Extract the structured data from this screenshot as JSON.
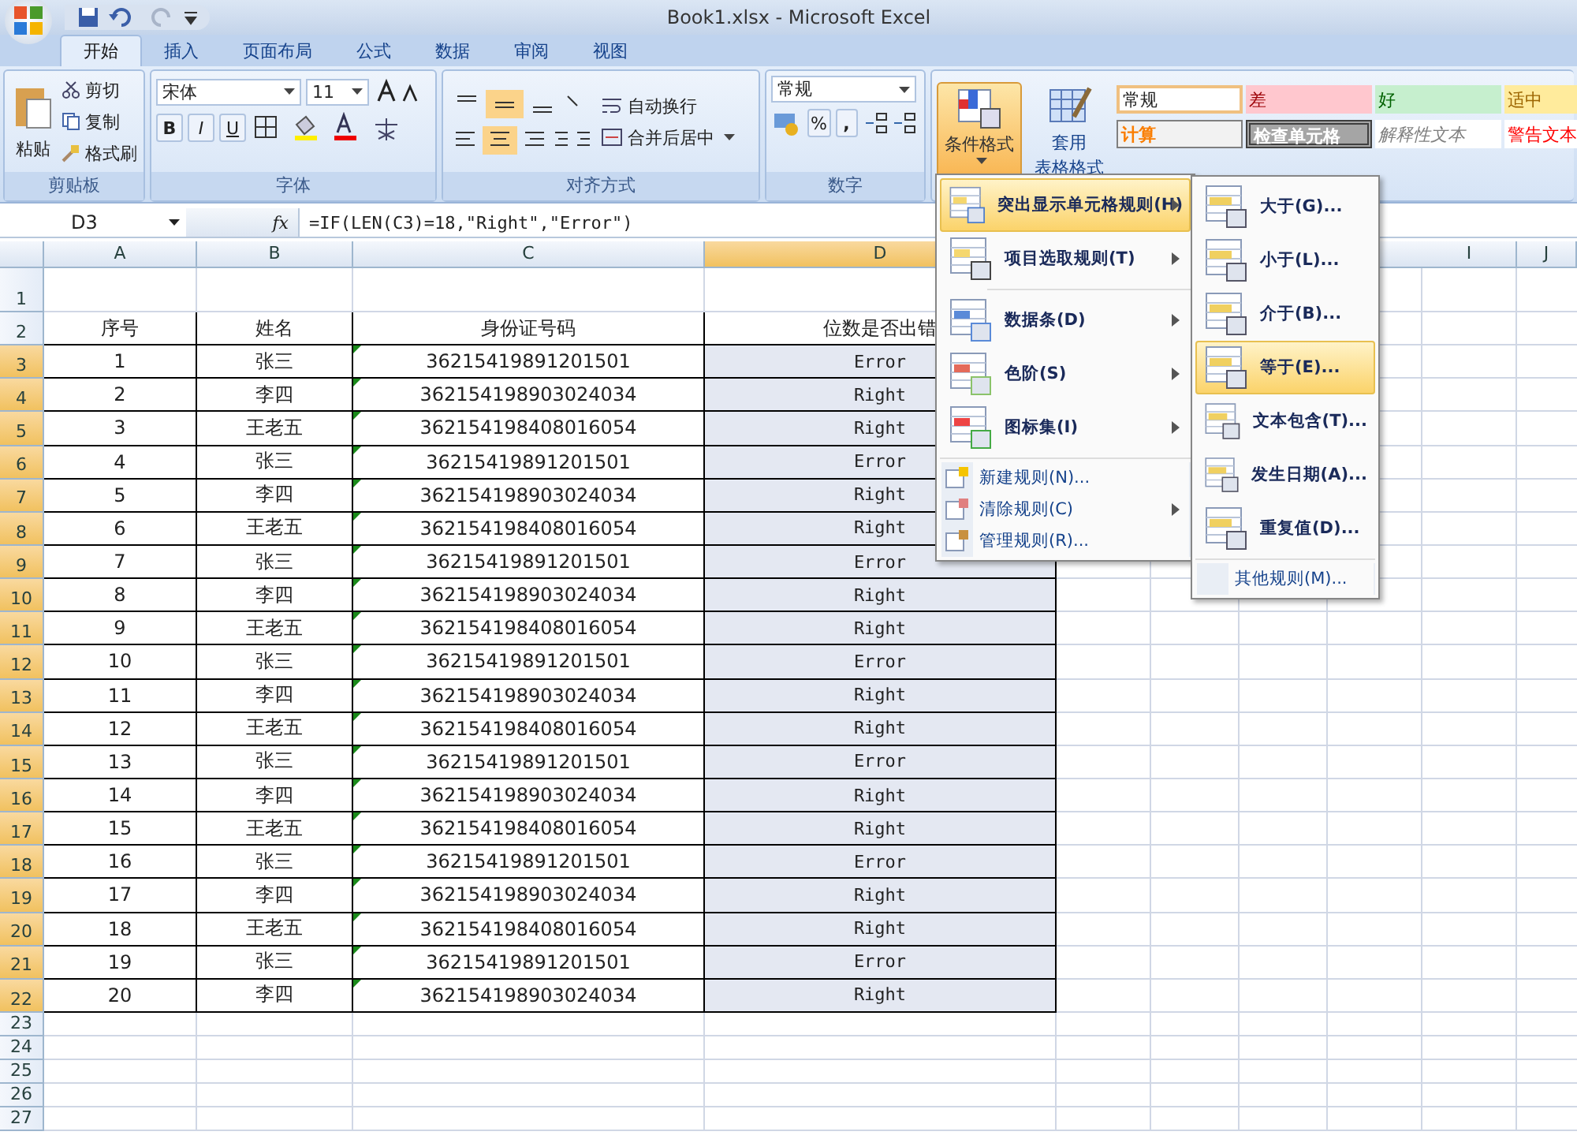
{
  "title": "Book1.xlsx - Microsoft Excel",
  "tabs": [
    {
      "label": "开始",
      "selected": true
    },
    {
      "label": "插入",
      "selected": false
    },
    {
      "label": "页面布局",
      "selected": false
    },
    {
      "label": "公式",
      "selected": false
    },
    {
      "label": "数据",
      "selected": false
    },
    {
      "label": "审阅",
      "selected": false
    },
    {
      "label": "视图",
      "selected": false
    }
  ],
  "clipboard": {
    "paste": "粘贴",
    "cut": "剪切",
    "copy": "复制",
    "painter": "格式刷",
    "label": "剪贴板"
  },
  "font": {
    "name": "宋体",
    "size": "11",
    "bold": "B",
    "italic": "I",
    "underline": "U",
    "label": "字体"
  },
  "alignment": {
    "wrap": "自动换行",
    "merge": "合并后居中",
    "label": "对齐方式"
  },
  "number": {
    "format": "常规",
    "percent": "%",
    "comma": ",",
    "label": "数字"
  },
  "styles": {
    "conditional": {
      "label": "条件格式",
      "selected": true
    },
    "table_format": {
      "line1": "套用",
      "line2": "表格格式"
    },
    "cell_styles": [
      {
        "label": "常规",
        "kind": "normal"
      },
      {
        "label": "差",
        "kind": "bad"
      },
      {
        "label": "好",
        "kind": "good"
      },
      {
        "label": "适中",
        "kind": "neutral"
      },
      {
        "label": "计算",
        "kind": "calc"
      },
      {
        "label": "检查单元格",
        "kind": "check"
      },
      {
        "label": "解释性文本",
        "kind": "explanatory"
      },
      {
        "label": "警告文本",
        "kind": "warning"
      }
    ]
  },
  "formula_bar": {
    "name_box": "D3",
    "fx": "fx",
    "formula": "=IF(LEN(C3)=18,\"Right\",\"Error\")"
  },
  "columns": [
    {
      "letter": "A",
      "selected": false
    },
    {
      "letter": "B",
      "selected": false
    },
    {
      "letter": "C",
      "selected": false
    },
    {
      "letter": "D",
      "selected": true
    },
    {
      "letter": "I",
      "selected": false
    },
    {
      "letter": "J",
      "selected": false
    }
  ],
  "rows": [
    {
      "num": "1",
      "selected": false
    },
    {
      "num": "2",
      "selected": false,
      "cells": [
        "序号",
        "姓名",
        "身份证号码",
        "位数是否出错"
      ]
    },
    {
      "num": "3",
      "selected": true,
      "warning": true,
      "cells": [
        "1",
        "张三",
        "36215419891201501",
        "Error"
      ]
    },
    {
      "num": "4",
      "selected": true,
      "warning": true,
      "cells": [
        "2",
        "李四",
        "362154198903024034",
        "Right"
      ]
    },
    {
      "num": "5",
      "selected": true,
      "warning": true,
      "cells": [
        "3",
        "王老五",
        "362154198408016054",
        "Right"
      ]
    },
    {
      "num": "6",
      "selected": true,
      "warning": true,
      "cells": [
        "4",
        "张三",
        "36215419891201501",
        "Error"
      ]
    },
    {
      "num": "7",
      "selected": true,
      "warning": true,
      "cells": [
        "5",
        "李四",
        "362154198903024034",
        "Right"
      ]
    },
    {
      "num": "8",
      "selected": true,
      "warning": true,
      "cells": [
        "6",
        "王老五",
        "362154198408016054",
        "Right"
      ]
    },
    {
      "num": "9",
      "selected": true,
      "warning": true,
      "cells": [
        "7",
        "张三",
        "36215419891201501",
        "Error"
      ]
    },
    {
      "num": "10",
      "selected": true,
      "warning": true,
      "cells": [
        "8",
        "李四",
        "362154198903024034",
        "Right"
      ]
    },
    {
      "num": "11",
      "selected": true,
      "warning": true,
      "cells": [
        "9",
        "王老五",
        "362154198408016054",
        "Right"
      ]
    },
    {
      "num": "12",
      "selected": true,
      "warning": true,
      "cells": [
        "10",
        "张三",
        "36215419891201501",
        "Error"
      ]
    },
    {
      "num": "13",
      "selected": true,
      "warning": true,
      "cells": [
        "11",
        "李四",
        "362154198903024034",
        "Right"
      ]
    },
    {
      "num": "14",
      "selected": true,
      "warning": true,
      "cells": [
        "12",
        "王老五",
        "362154198408016054",
        "Right"
      ]
    },
    {
      "num": "15",
      "selected": true,
      "warning": true,
      "cells": [
        "13",
        "张三",
        "36215419891201501",
        "Error"
      ]
    },
    {
      "num": "16",
      "selected": true,
      "warning": true,
      "cells": [
        "14",
        "李四",
        "362154198903024034",
        "Right"
      ]
    },
    {
      "num": "17",
      "selected": true,
      "warning": true,
      "cells": [
        "15",
        "王老五",
        "362154198408016054",
        "Right"
      ]
    },
    {
      "num": "18",
      "selected": true,
      "warning": true,
      "cells": [
        "16",
        "张三",
        "36215419891201501",
        "Error"
      ]
    },
    {
      "num": "19",
      "selected": true,
      "warning": true,
      "cells": [
        "17",
        "李四",
        "362154198903024034",
        "Right"
      ]
    },
    {
      "num": "20",
      "selected": true,
      "warning": true,
      "cells": [
        "18",
        "王老五",
        "362154198408016054",
        "Right"
      ]
    },
    {
      "num": "21",
      "selected": true,
      "warning": true,
      "cells": [
        "19",
        "张三",
        "36215419891201501",
        "Error"
      ]
    },
    {
      "num": "22",
      "selected": true,
      "warning": true,
      "cells": [
        "20",
        "李四",
        "362154198903024034",
        "Right"
      ]
    },
    {
      "num": "23",
      "selected": false
    },
    {
      "num": "24",
      "selected": false
    },
    {
      "num": "25",
      "selected": false
    },
    {
      "num": "26",
      "selected": false
    },
    {
      "num": "27",
      "selected": false
    }
  ],
  "menu": [
    {
      "label": "突出显示单元格规则(H)",
      "kind": "large",
      "submenu": true,
      "selected": true
    },
    {
      "label": "项目选取规则(T)",
      "kind": "large",
      "submenu": true,
      "selected": false
    },
    {
      "label": "数据条(D)",
      "kind": "large",
      "submenu": true,
      "selected": false
    },
    {
      "label": "色阶(S)",
      "kind": "large",
      "submenu": true,
      "selected": false
    },
    {
      "label": "图标集(I)",
      "kind": "large",
      "submenu": true,
      "selected": false
    },
    {
      "label": "新建规则(N)...",
      "kind": "small",
      "submenu": false,
      "selected": false
    },
    {
      "label": "清除规则(C)",
      "kind": "small",
      "submenu": true,
      "selected": false
    },
    {
      "label": "管理规则(R)...",
      "kind": "small",
      "submenu": false,
      "selected": false
    }
  ],
  "submenu": [
    {
      "label": "大于(G)...",
      "kind": "large",
      "selected": false
    },
    {
      "label": "小于(L)...",
      "kind": "large",
      "selected": false
    },
    {
      "label": "介于(B)...",
      "kind": "large",
      "selected": false
    },
    {
      "label": "等于(E)...",
      "kind": "large",
      "selected": true
    },
    {
      "label": "文本包含(T)...",
      "kind": "large",
      "selected": false
    },
    {
      "label": "发生日期(A)...",
      "kind": "large",
      "selected": false
    },
    {
      "label": "重复值(D)...",
      "kind": "large",
      "selected": false
    },
    {
      "label": "其他规则(M)...",
      "kind": "small",
      "selected": false
    }
  ]
}
